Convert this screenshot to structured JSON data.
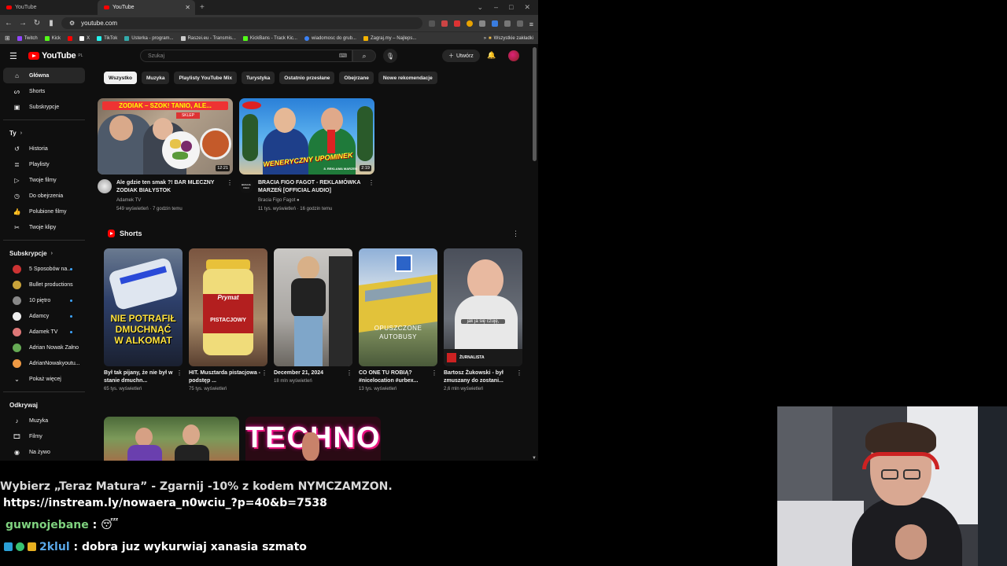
{
  "browser": {
    "tabs": [
      {
        "label": "YouTube"
      },
      {
        "label": "YouTube"
      }
    ],
    "new_tab": "+",
    "url": "youtube.com",
    "bookmarks": [
      {
        "label": "Twitch",
        "color": "#9146ff"
      },
      {
        "label": "Kick",
        "color": "#53fc18"
      },
      {
        "label": "X",
        "color": "#ffffff"
      },
      {
        "label": "TikTok",
        "color": "#25f4ee"
      },
      {
        "label": "Usterka - program...",
        "color": "#3aa"
      },
      {
        "label": "Raszei.eu - Transmis...",
        "color": "#ccc"
      },
      {
        "label": "KickBans - Track Kic...",
        "color": "#53fc18"
      },
      {
        "label": "wiadomosc do grub...",
        "color": "#3b82f6"
      },
      {
        "label": "Zagraj.my – Najleps...",
        "color": "#f5b301"
      }
    ],
    "bookmarks_all": "Wszystkie zakładki"
  },
  "youtube": {
    "logo_text": "YouTube",
    "logo_region": "PL",
    "search_placeholder": "Szukaj",
    "create_label": "Utwórz",
    "sidebar": {
      "main": [
        {
          "label": "Główna",
          "icon": "home-icon"
        },
        {
          "label": "Shorts",
          "icon": "shorts-icon"
        },
        {
          "label": "Subskrypcje",
          "icon": "subscriptions-icon"
        }
      ],
      "you_header": "Ty",
      "you": [
        {
          "label": "Historia"
        },
        {
          "label": "Playlisty"
        },
        {
          "label": "Twoje filmy"
        },
        {
          "label": "Do obejrzenia"
        },
        {
          "label": "Polubione filmy"
        },
        {
          "label": "Twoje klipy"
        }
      ],
      "subs_header": "Subskrypcje",
      "subs": [
        {
          "label": "5 Sposobów na...",
          "color": "#c33"
        },
        {
          "label": "Bullet productions",
          "color": "#c8a23a"
        },
        {
          "label": "10 piętro",
          "color": "#888"
        },
        {
          "label": "Adamcy",
          "color": "#eee"
        },
        {
          "label": "Adamek TV",
          "color": "#d77"
        },
        {
          "label": "Adrian Nowak Załno",
          "color": "#6a5"
        },
        {
          "label": "AdrianNowakyoutu...",
          "color": "#e94"
        }
      ],
      "show_more": "Pokaż więcej",
      "explore_header": "Odkrywaj",
      "explore": [
        {
          "label": "Muzyka"
        },
        {
          "label": "Filmy"
        },
        {
          "label": "Na żywo"
        }
      ]
    },
    "chips": [
      "Wszystko",
      "Muzyka",
      "Playlisty YouTube Mix",
      "Turystyka",
      "Ostatnio przesłane",
      "Obejrzane",
      "Nowe rekomendacje"
    ],
    "videos": [
      {
        "title": "Ale gdzie ten smak ?! BAR MLECZNY ZODIAK BIAŁYSTOK",
        "channel": "Adamek TV",
        "stats": "549 wyświetleń · 7 godzin temu",
        "duration": "12:21",
        "thumb_caption": "ZODIAK – SZOK! TANIO, ALE...",
        "thumb_sign": "SKLEP"
      },
      {
        "title": "BRACIA FIGO FAGOT - REKLAMÓWKA MARZEŃ [OFFICIAL AUDIO]",
        "channel": "Bracia Figo Fagot",
        "stats": "11 tys. wyświetleń · 16 godzin temu",
        "duration": "2:19",
        "thumb_caption": "WENERYCZNY UPOMINEK",
        "thumb_tag": "8. REKLAMA MARZEŃ",
        "channel_avatar_text": "BRACIA FIGO"
      }
    ],
    "shorts_header": "Shorts",
    "shorts": [
      {
        "title": "Był tak pijany, że nie był w stanie dmuchn...",
        "views": "65 tys. wyświetleń",
        "overlay": "NIE POTRAFIŁ DMUCHNĄĆ W ALKOMAT"
      },
      {
        "title": "HIT. Musztarda pistacjowa - podstęp ...",
        "views": "75 tys. wyświetleń",
        "overlay": "Prymat",
        "overlay2": "PISTACJOWY"
      },
      {
        "title": "December 21, 2024",
        "views": "18 mln wyświetleń"
      },
      {
        "title": "CO ONE TU ROBIĄ? #nicelocation #urbex...",
        "views": "13 tys. wyświetleń",
        "overlay": "OPUSZCZONE AUTOBUSY"
      },
      {
        "title": "Bartosz Żukowski - był zmuszany do zostani...",
        "views": "2,6 mln wyświetleń",
        "overlay": "jak ja się czuję,",
        "overlay2": "ŻURNALISTA"
      }
    ],
    "row3_overlay": "TECHNO"
  },
  "stream_chat": {
    "cut_line": "Wybierz „Teraz Matura” -  Zgarnij   -10% z kodem NYMCZAMZON.",
    "link_line": "https://instream.ly/nowaera_n0wciu_?p=40&b=7538",
    "messages": [
      {
        "user": "guwnojebane",
        "sep": " : ",
        "text": "",
        "emote": "😴"
      },
      {
        "user": "2klul",
        "sep": " : ",
        "text": "dobra juz wykurwiaj xanasia szmato"
      }
    ]
  },
  "colors": {
    "yt_red": "#ff0000",
    "yt_bg": "#0f0f0f",
    "chip_bg": "#272727",
    "chat_user_green": "#7fd27f",
    "chat_user_blue": "#5aa8e8"
  }
}
